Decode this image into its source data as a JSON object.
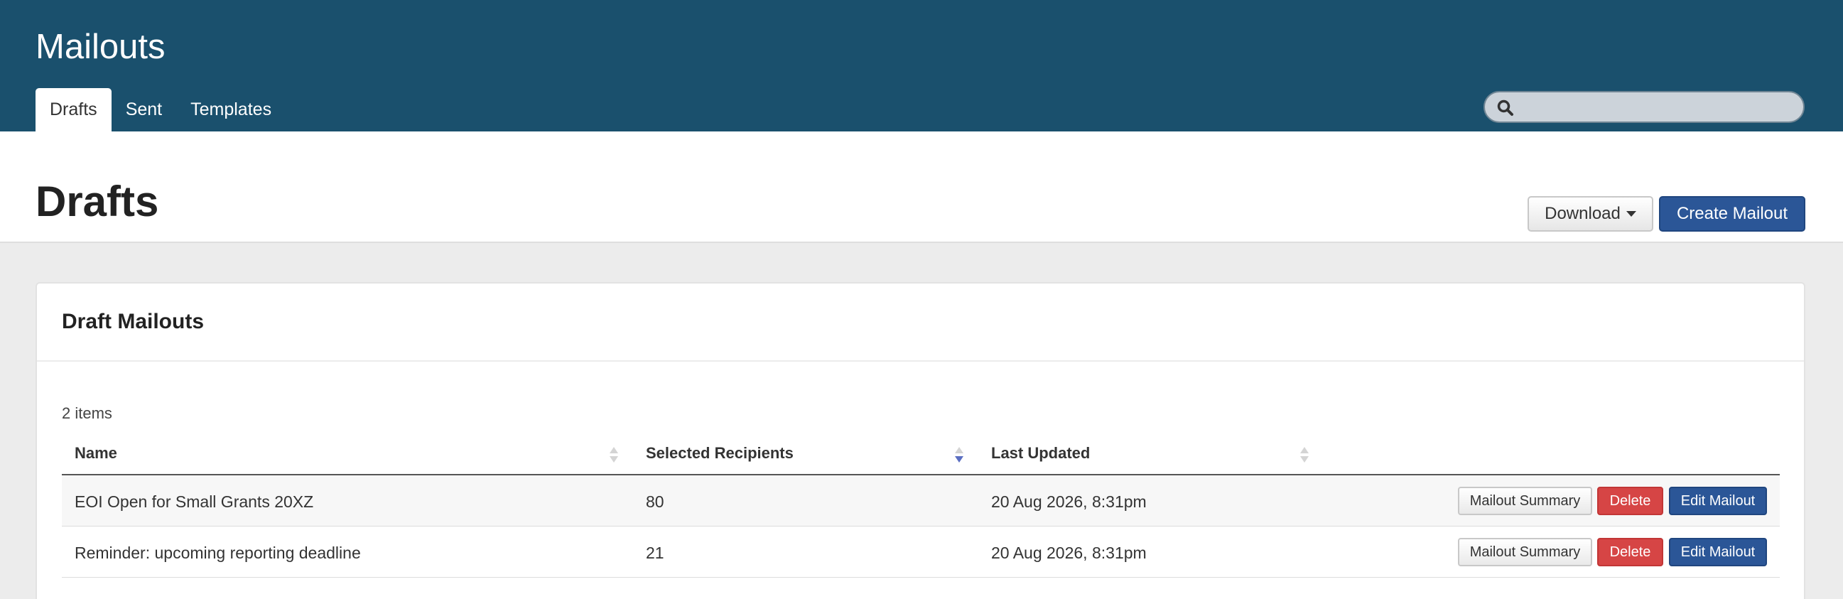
{
  "app": {
    "title": "Mailouts"
  },
  "nav": {
    "tabs": [
      {
        "label": "Drafts",
        "active": true
      },
      {
        "label": "Sent",
        "active": false
      },
      {
        "label": "Templates",
        "active": false
      }
    ]
  },
  "search": {
    "value": "",
    "placeholder": "",
    "icon": "search-icon"
  },
  "page": {
    "title": "Drafts",
    "download_label": "Download",
    "create_label": "Create Mailout"
  },
  "panel": {
    "title": "Draft Mailouts",
    "count": "2 items",
    "columns": [
      "Name",
      "Selected Recipients",
      "Last Updated"
    ],
    "sorted_column": "Selected Recipients",
    "rows": [
      {
        "name": "EOI Open for Small Grants 20XZ",
        "recipients": "80",
        "updated": "20 Aug 2026, 8:31pm",
        "summary_label": "Mailout Summary",
        "delete_label": "Delete",
        "edit_label": "Edit Mailout"
      },
      {
        "name": "Reminder: upcoming reporting deadline",
        "recipients": "21",
        "updated": "20 Aug 2026, 8:31pm",
        "summary_label": "Mailout Summary",
        "delete_label": "Delete",
        "edit_label": "Edit Mailout"
      }
    ]
  },
  "colors": {
    "header_bg": "#1a506d",
    "primary": "#2b5697",
    "danger": "#d64545",
    "page_bg": "#ececec"
  }
}
